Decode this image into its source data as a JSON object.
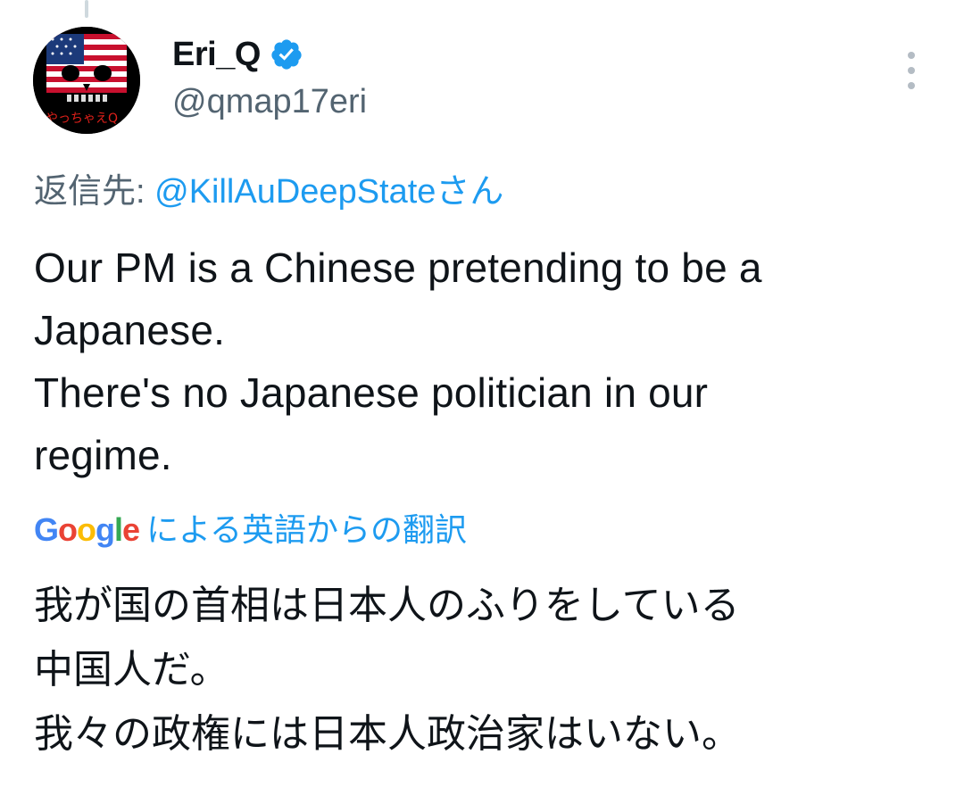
{
  "author": {
    "display_name": "Eri_Q",
    "handle": "@qmap17eri",
    "verified": true,
    "verified_color": "#1d9bf0",
    "avatar_text": "やっちゃえQ"
  },
  "reply": {
    "prefix": "返信先: ",
    "mention": "@KillAuDeepStateさん"
  },
  "tweet": {
    "lines": [
      "Our PM is a Chinese pretending to be a",
      "Japanese.",
      "There's no Japanese politician in our",
      "regime."
    ]
  },
  "translation": {
    "google_letters": [
      {
        "ch": "G",
        "color": "#4285f4"
      },
      {
        "ch": "o",
        "color": "#ea4335"
      },
      {
        "ch": "o",
        "color": "#fbbc05"
      },
      {
        "ch": "g",
        "color": "#4285f4"
      },
      {
        "ch": "l",
        "color": "#34a853"
      },
      {
        "ch": "e",
        "color": "#ea4335"
      }
    ],
    "label": "による英語からの翻訳",
    "lines": [
      "我が国の首相は日本人のふりをしている",
      "中国人だ。",
      "我々の政権には日本人政治家はいない。"
    ]
  },
  "colors": {
    "accent": "#1d9bf0",
    "text": "#0f1419",
    "secondary": "#536471"
  },
  "icons": {
    "more": "more-vertical-icon",
    "verified": "verified-badge-icon"
  }
}
